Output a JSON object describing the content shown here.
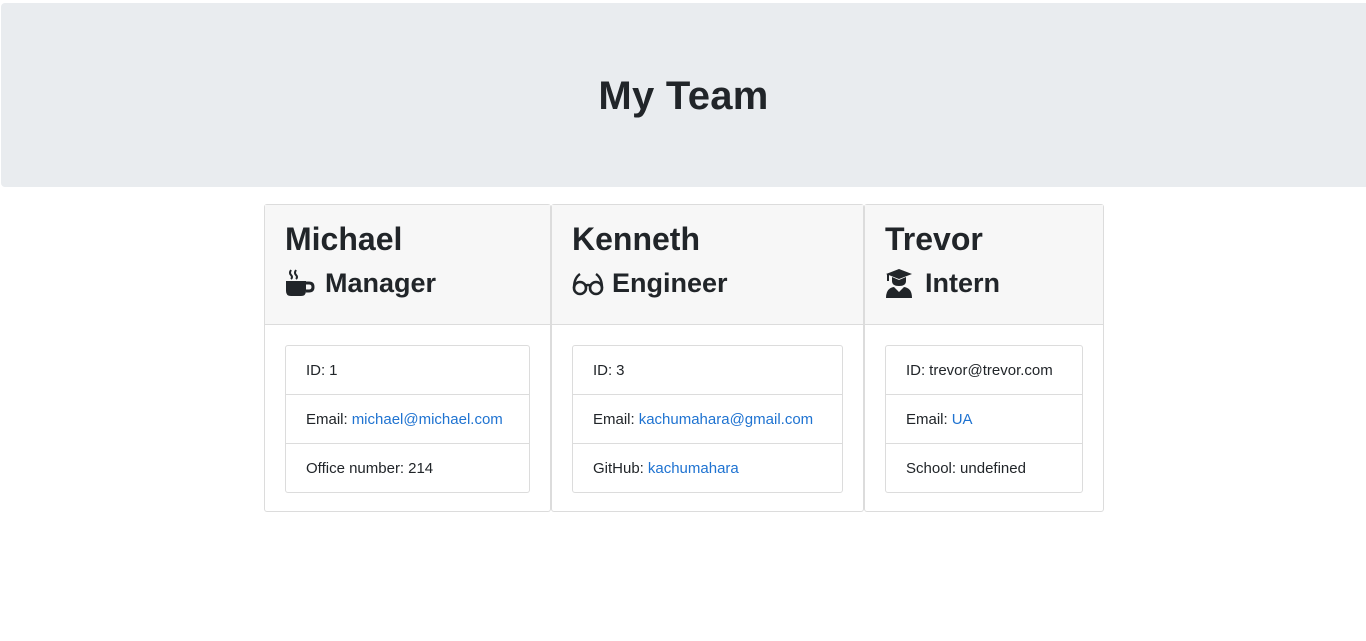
{
  "header": {
    "title": "My Team"
  },
  "employees": [
    {
      "name": "Michael",
      "role": "Manager",
      "role_icon": "coffee-mug-icon",
      "rows": [
        {
          "label": "ID:",
          "value": "1"
        },
        {
          "label": "Email:",
          "link": "michael@michael.com"
        },
        {
          "label": "Office number:",
          "value": "214"
        }
      ]
    },
    {
      "name": "Kenneth",
      "role": "Engineer",
      "role_icon": "glasses-icon",
      "rows": [
        {
          "label": "ID:",
          "value": "3"
        },
        {
          "label": "Email:",
          "link": "kachumahara@gmail.com"
        },
        {
          "label": "GitHub:",
          "link": "kachumahara"
        }
      ]
    },
    {
      "name": "Trevor",
      "role": "Intern",
      "role_icon": "graduate-icon",
      "rows": [
        {
          "label": "ID:",
          "value": "trevor@trevor.com"
        },
        {
          "label": "Email:",
          "link": "UA"
        },
        {
          "label": "School:",
          "value": "undefined"
        }
      ]
    }
  ],
  "colors": {
    "header_bg": "#e9ecef",
    "link": "#1f73d1",
    "text": "#212529"
  }
}
